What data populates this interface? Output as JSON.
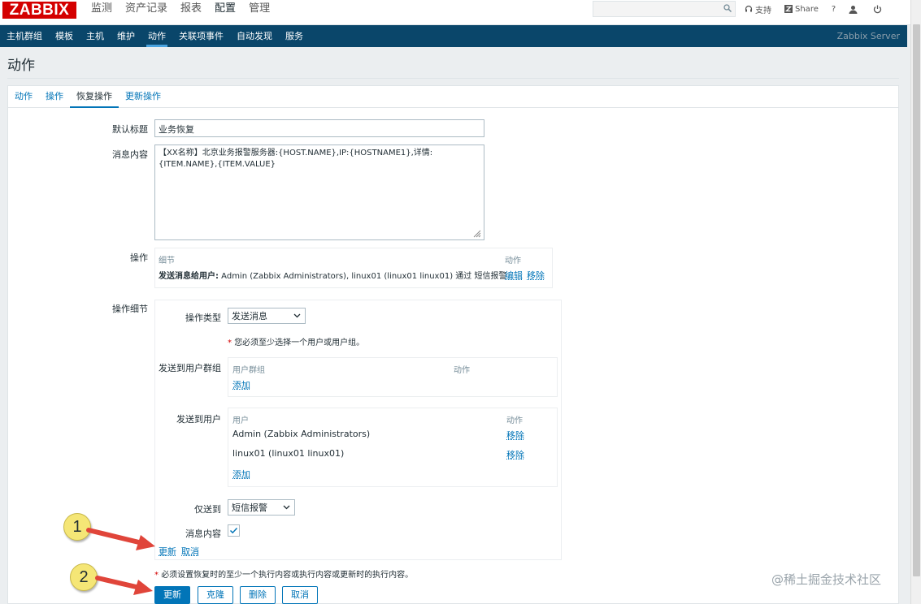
{
  "header": {
    "logo": "ZABBIX",
    "menu": [
      "监测",
      "资产记录",
      "报表",
      "配置",
      "管理"
    ],
    "active_menu_index": 3,
    "support": "支持",
    "share": "Share",
    "help": "?"
  },
  "subnav": {
    "items": [
      "主机群组",
      "模板",
      "主机",
      "维护",
      "动作",
      "关联项事件",
      "自动发现",
      "服务"
    ],
    "active_index": 4,
    "server": "Zabbix Server"
  },
  "page": {
    "title": "动作"
  },
  "tabs": [
    "动作",
    "操作",
    "恢复操作",
    "更新操作"
  ],
  "active_tab_index": 2,
  "form": {
    "default_subject_label": "默认标题",
    "default_subject_value": "业务恢复",
    "message_label": "消息内容",
    "message_value": "【XX名称】北京业务报警服务器:{HOST.NAME},IP:{HOSTNAME1},详情:\n{ITEM.NAME},{ITEM.VALUE}",
    "operations_label": "操作",
    "operations_header_details": "细节",
    "operations_header_action": "动作",
    "operation_row_bold": "发送消息给用户:",
    "operation_row_text": " Admin (Zabbix Administrators), linux01 (linux01 linux01) 通过 短信报警",
    "edit_link": "编辑",
    "remove_link": "移除",
    "op_details_label": "操作细节",
    "op_type_label": "操作类型",
    "op_type_value": "发送消息",
    "must_select_note": "您必须至少选择一个用户或用户组。",
    "send_to_groups_label": "发送到用户群组",
    "groups_header": "用户群组",
    "groups_action_header": "动作",
    "add_link": "添加",
    "send_to_users_label": "发送到用户",
    "users_header": "用户",
    "users_action_header": "动作",
    "users": [
      {
        "name": "Admin (Zabbix Administrators)",
        "action": "移除"
      },
      {
        "name": "linux01 (linux01 linux01)",
        "action": "移除"
      }
    ],
    "send_only_to_label": "仅送到",
    "send_only_to_value": "短信报警",
    "message_content_label": "消息内容",
    "message_content_checked": true,
    "update_link": "更新",
    "cancel_link": "取消",
    "required_note": "必须设置恢复时的至少一个执行内容或执行内容或更新时的执行内容。"
  },
  "buttons": {
    "update": "更新",
    "clone": "克隆",
    "delete": "删除",
    "cancel": "取消"
  },
  "callouts": [
    "1",
    "2"
  ],
  "watermark": "@稀土掘金技术社区",
  "colors": {
    "brand": "#d40000",
    "nav": "#0a466a",
    "link": "#0275b8",
    "callout": "#f5e676",
    "arrow": "#e0453a"
  }
}
